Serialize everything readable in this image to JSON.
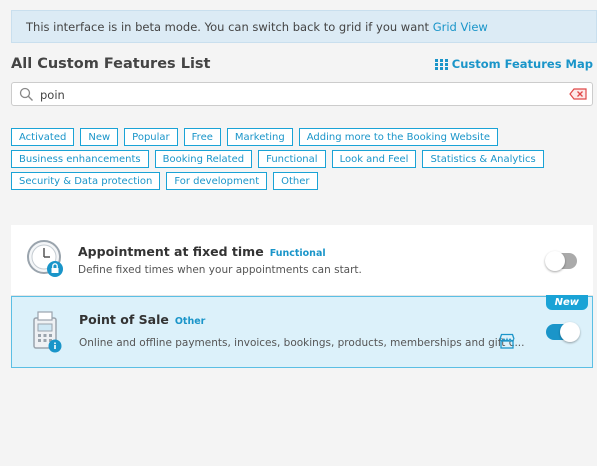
{
  "beta_banner": {
    "text": "This interface is in beta mode. You can switch back to grid if you want ",
    "link": "Grid View"
  },
  "header": {
    "title": "All Custom Features List",
    "map_link": "Custom Features Map"
  },
  "search": {
    "value": "poin"
  },
  "tags": [
    [
      "Activated",
      "New",
      "Popular",
      "Free",
      "Marketing",
      "Adding more to the Booking Website"
    ],
    [
      "Business enhancements",
      "Booking Related",
      "Functional",
      "Look and Feel",
      "Statistics & Analytics"
    ],
    [
      "Security & Data protection",
      "For development",
      "Other"
    ]
  ],
  "features": [
    {
      "name": "Appointment at fixed time",
      "category": "Functional",
      "description": "Define fixed times when your appointments can start.",
      "enabled": false,
      "is_new": false
    },
    {
      "name": "Point of Sale",
      "category": "Other",
      "description": "Online and offline payments, invoices, bookings, products, memberships and gift c...",
      "enabled": true,
      "is_new": true,
      "badge": "New"
    }
  ],
  "colors": {
    "accent": "#1a95c9",
    "selected_card_bg": "#dcf1fa",
    "banner_bg": "#dcebf5"
  }
}
